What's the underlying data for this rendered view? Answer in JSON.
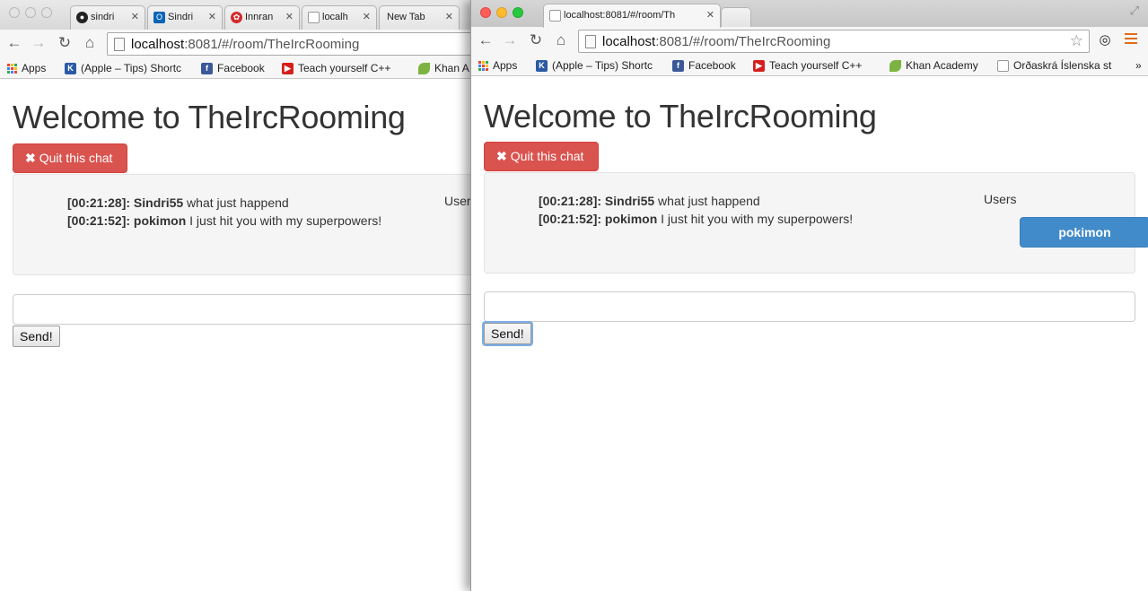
{
  "left_window": {
    "tabs": [
      {
        "label": "sindri",
        "icon": "github-icon"
      },
      {
        "label": "Sindri",
        "icon": "outlook-icon"
      },
      {
        "label": "Innran",
        "icon": "innra-icon"
      },
      {
        "label": "localh",
        "icon": "page-icon"
      },
      {
        "label": "New Tab",
        "icon": ""
      }
    ],
    "url_host": "localhost",
    "url_rest": ":8081/#/room/TheIrcRooming",
    "bookmarks": [
      "Apps",
      "(Apple – Tips) Shortc",
      "Facebook",
      "Teach yourself C++",
      "Khan A"
    ],
    "page": {
      "title": "Welcome to TheIrcRooming",
      "quit_label": "Quit this chat",
      "messages": [
        {
          "time": "[00:21:28]:",
          "user": "Sindri55",
          "text": " what just happend"
        },
        {
          "time": "[00:21:52]:",
          "user": "pokimon",
          "text": " I just hit you with my superpowers!"
        }
      ],
      "users_label": "Users",
      "message_value": "",
      "send_label": "Send!"
    }
  },
  "right_window": {
    "tabs": [
      {
        "label": "localhost:8081/#/room/Th",
        "icon": "page-icon"
      }
    ],
    "url_host": "localhost",
    "url_rest": ":8081/#/room/TheIrcRooming",
    "bookmarks": [
      "Apps",
      "(Apple – Tips) Shortc",
      "Facebook",
      "Teach yourself C++",
      "Khan Academy",
      "Orðaskrá Íslenska st"
    ],
    "page": {
      "title": "Welcome to TheIrcRooming",
      "quit_label": "Quit this chat",
      "messages": [
        {
          "time": "[00:21:28]:",
          "user": "Sindri55",
          "text": " what just happend"
        },
        {
          "time": "[00:21:52]:",
          "user": "pokimon",
          "text": " I just hit you with my superpowers!"
        }
      ],
      "users_label": "Users",
      "users": [
        "pokimon"
      ],
      "message_value": "",
      "send_label": "Send!"
    }
  },
  "colors": {
    "danger": "#d9534f",
    "primary": "#428bca",
    "well": "#f5f5f5"
  }
}
